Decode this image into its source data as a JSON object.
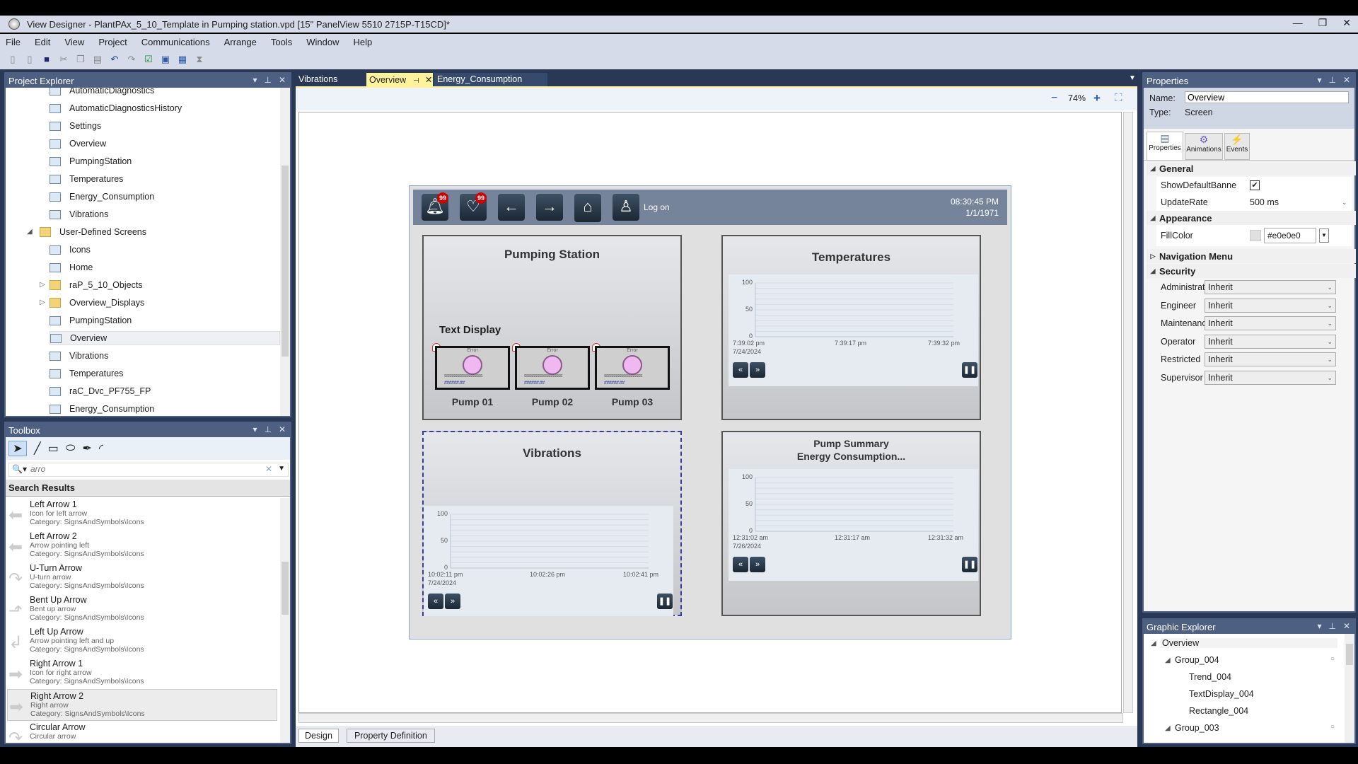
{
  "app": {
    "title": "View Designer - PlantPAx_5_10_Template in Pumping station.vpd [15\" PanelView 5510 2715P-T15CD]*"
  },
  "menu": [
    "File",
    "Edit",
    "View",
    "Project",
    "Communications",
    "Arrange",
    "Tools",
    "Window",
    "Help"
  ],
  "project_explorer": {
    "title": "Project Explorer",
    "items": [
      {
        "label": "AutomaticDiagnostics",
        "level": 2,
        "icon": "shortcut-screen-icon"
      },
      {
        "label": "AutomaticDiagnosticsHistory",
        "level": 2,
        "icon": "shortcut-screen-icon"
      },
      {
        "label": "Settings",
        "level": 2,
        "icon": "shortcut-screen-icon"
      },
      {
        "label": "Overview",
        "level": 2,
        "icon": "home-screen-icon"
      },
      {
        "label": "PumpingStation",
        "level": 2,
        "icon": "shortcut-screen-icon"
      },
      {
        "label": "Temperatures",
        "level": 2,
        "icon": "shortcut-screen-icon"
      },
      {
        "label": "Energy_Consumption",
        "level": 2,
        "icon": "shortcut-screen-icon"
      },
      {
        "label": "Vibrations",
        "level": 2,
        "icon": "shortcut-screen-icon"
      },
      {
        "label": "User-Defined Screens",
        "level": 1,
        "icon": "folder-icon",
        "expanded": true
      },
      {
        "label": "Icons",
        "level": 2,
        "icon": "screen-icon"
      },
      {
        "label": "Home",
        "level": 2,
        "icon": "screen-icon"
      },
      {
        "label": "raP_5_10_Objects",
        "level": 2,
        "icon": "folder-icon",
        "expanded": false
      },
      {
        "label": "Overview_Displays",
        "level": 2,
        "icon": "folder-icon",
        "expanded": false
      },
      {
        "label": "PumpingStation",
        "level": 2,
        "icon": "screen-icon"
      },
      {
        "label": "Overview",
        "level": 2,
        "icon": "screen-icon",
        "selected": true
      },
      {
        "label": "Vibrations",
        "level": 2,
        "icon": "screen-icon"
      },
      {
        "label": "Temperatures",
        "level": 2,
        "icon": "screen-icon"
      },
      {
        "label": "raC_Dvc_PF755_FP",
        "level": 2,
        "icon": "device-icon"
      },
      {
        "label": "Energy_Consumption",
        "level": 2,
        "icon": "screen-icon"
      }
    ]
  },
  "toolbox": {
    "title": "Toolbox",
    "search_value": "arro",
    "results_header": "Search Results",
    "results": [
      {
        "name": "Left Arrow 1",
        "desc": "Icon for left arrow",
        "category": "Category: SignsAndSymbols\\Icons",
        "glyph": "⬅"
      },
      {
        "name": "Left Arrow 2",
        "desc": "Arrow pointing left",
        "category": "Category: SignsAndSymbols\\Icons",
        "glyph": "⬅"
      },
      {
        "name": "U-Turn Arrow",
        "desc": "U-turn arrow",
        "category": "Category: SignsAndSymbols\\Icons",
        "glyph": "↷"
      },
      {
        "name": "Bent Up Arrow",
        "desc": "Bent up arrow",
        "category": "Category: SignsAndSymbols\\Icons",
        "glyph": "⬏"
      },
      {
        "name": "Left Up Arrow",
        "desc": "Arrow pointing left and up",
        "category": "Category: SignsAndSymbols\\Icons",
        "glyph": "↲"
      },
      {
        "name": "Right Arrow 1",
        "desc": "Icon for right arrow",
        "category": "Category: SignsAndSymbols\\Icons",
        "glyph": "➡"
      },
      {
        "name": "Right Arrow 2",
        "desc": "Right arrow",
        "category": "Category: SignsAndSymbols\\Icons",
        "glyph": "➡",
        "selected": true
      },
      {
        "name": "Circular Arrow",
        "desc": "Circular arrow",
        "category": "",
        "glyph": "↷"
      }
    ]
  },
  "document": {
    "tabs": [
      {
        "label": "Vibrations"
      },
      {
        "label": "Overview",
        "active": true
      },
      {
        "label": "Energy_Consumption"
      }
    ],
    "zoom": "74%",
    "bottom_tabs": [
      "Design",
      "Property Definition"
    ]
  },
  "hmi": {
    "time": "08:30:45 PM",
    "date": "1/1/1971",
    "logon": "Log on",
    "alarm_count": "99",
    "diag_count": "99",
    "pumping_station": {
      "title": "Pumping Station",
      "text_display": "Text Display",
      "pumps": [
        {
          "label": "Pump 01"
        },
        {
          "label": "Pump 02"
        },
        {
          "label": "Pump 03"
        }
      ],
      "pump_status": "Error",
      "pump_hash": "######.##",
      "pump_s": "ssssssssssssssssss"
    },
    "trends": [
      {
        "title": "Temperatures",
        "y_ticks": [
          "100",
          "50",
          "0"
        ],
        "x_ticks": [
          "7:39:02 pm",
          "7:39:17 pm",
          "7:39:32 pm"
        ],
        "date": "7/24/2024"
      },
      {
        "title": "Vibrations",
        "y_ticks": [
          "100",
          "50",
          "0"
        ],
        "x_ticks": [
          "10:02:11 pm",
          "10:02:26 pm",
          "10:02:41 pm"
        ],
        "date": "7/24/2024"
      },
      {
        "title": "Pump Summary",
        "subtitle": "Energy Consumption...",
        "y_ticks": [
          "100",
          "50",
          "0"
        ],
        "x_ticks": [
          "12:31:02 am",
          "12:31:17 am",
          "12:31:32 am"
        ],
        "date": "7/26/2024"
      }
    ]
  },
  "properties": {
    "title": "Properties",
    "name_label": "Name:",
    "name_value": "Overview",
    "type_label": "Type:",
    "type_value": "Screen",
    "tabs": [
      "Properties",
      "Animations",
      "Events"
    ],
    "general": "General",
    "show_default_banner": "ShowDefaultBanne",
    "show_default_banner_checked": true,
    "update_rate_label": "UpdateRate",
    "update_rate": "500 ms",
    "appearance": "Appearance",
    "fill_color_label": "FillColor",
    "fill_color": "#e0e0e0",
    "navigation_menu": "Navigation Menu",
    "security": "Security",
    "security_rows": [
      {
        "k": "Administrator",
        "v": "Inherit"
      },
      {
        "k": "Engineer",
        "v": "Inherit"
      },
      {
        "k": "Maintenance",
        "v": "Inherit"
      },
      {
        "k": "Operator",
        "v": "Inherit"
      },
      {
        "k": "Restricted",
        "v": "Inherit"
      },
      {
        "k": "Supervisor",
        "v": "Inherit"
      }
    ]
  },
  "graphic_explorer": {
    "title": "Graphic Explorer",
    "items": [
      {
        "label": "Overview",
        "level": 0
      },
      {
        "label": "Group_004",
        "level": 1
      },
      {
        "label": "Trend_004",
        "level": 2
      },
      {
        "label": "TextDisplay_004",
        "level": 2
      },
      {
        "label": "Rectangle_004",
        "level": 2
      },
      {
        "label": "Group_003",
        "level": 1
      }
    ]
  },
  "colors": {
    "accent_tab": "#fff29d",
    "chrome": "#293955",
    "panel_header": "#4d6082",
    "hmi_header": "#75849a"
  }
}
